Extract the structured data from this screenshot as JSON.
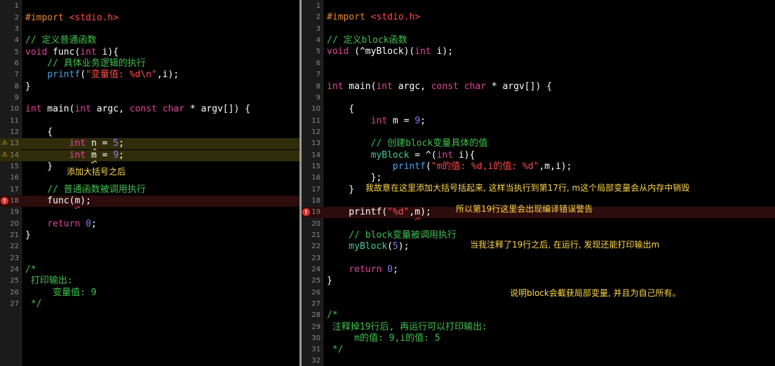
{
  "left": {
    "lines": [
      {
        "n": "1",
        "parts": []
      },
      {
        "n": "2",
        "parts": [
          {
            "c": "pp",
            "t": "#import "
          },
          {
            "c": "str",
            "t": "<stdio.h>"
          }
        ]
      },
      {
        "n": "3",
        "parts": []
      },
      {
        "n": "4",
        "parts": [
          {
            "c": "cm",
            "t": "// 定义普通函数"
          }
        ]
      },
      {
        "n": "5",
        "parts": [
          {
            "c": "kw",
            "t": "void"
          },
          {
            "c": "plain",
            "t": " func("
          },
          {
            "c": "kw",
            "t": "int"
          },
          {
            "c": "plain",
            "t": " i){"
          }
        ]
      },
      {
        "n": "6",
        "parts": [
          {
            "c": "cm",
            "t": "    // 具体业务逻辑的执行"
          }
        ]
      },
      {
        "n": "7",
        "parts": [
          {
            "c": "plain",
            "t": "    "
          },
          {
            "c": "fn",
            "t": "printf"
          },
          {
            "c": "plain",
            "t": "("
          },
          {
            "c": "str",
            "t": "\"变量值: %d\\n\""
          },
          {
            "c": "plain",
            "t": ",i);"
          }
        ]
      },
      {
        "n": "8",
        "parts": [
          {
            "c": "plain",
            "t": "}"
          }
        ]
      },
      {
        "n": "9",
        "parts": []
      },
      {
        "n": "10",
        "parts": [
          {
            "c": "kw",
            "t": "int"
          },
          {
            "c": "plain",
            "t": " main("
          },
          {
            "c": "kw",
            "t": "int"
          },
          {
            "c": "plain",
            "t": " argc, "
          },
          {
            "c": "kw",
            "t": "const char"
          },
          {
            "c": "plain",
            "t": " * argv[]) {"
          }
        ]
      },
      {
        "n": "11",
        "parts": []
      },
      {
        "n": "12",
        "parts": [
          {
            "c": "plain",
            "t": "    {"
          }
        ]
      },
      {
        "n": "13",
        "mark": "warn",
        "parts": [
          {
            "c": "plain",
            "t": "        "
          },
          {
            "c": "kw",
            "t": "int"
          },
          {
            "c": "plain",
            "t": " "
          },
          {
            "c": "plain squig",
            "t": "n"
          },
          {
            "c": "plain",
            "t": " = "
          },
          {
            "c": "num",
            "t": "5"
          },
          {
            "c": "plain",
            "t": ";"
          }
        ]
      },
      {
        "n": "14",
        "mark": "warn",
        "parts": [
          {
            "c": "plain",
            "t": "        "
          },
          {
            "c": "kw",
            "t": "int"
          },
          {
            "c": "plain",
            "t": " "
          },
          {
            "c": "plain squig",
            "t": "m"
          },
          {
            "c": "plain",
            "t": " = "
          },
          {
            "c": "num",
            "t": "9"
          },
          {
            "c": "plain",
            "t": ";"
          }
        ]
      },
      {
        "n": "15",
        "parts": [
          {
            "c": "plain",
            "t": "    }"
          }
        ]
      },
      {
        "n": "16",
        "parts": []
      },
      {
        "n": "17",
        "parts": [
          {
            "c": "cm",
            "t": "    // 普通函数被调用执行"
          }
        ]
      },
      {
        "n": "18",
        "mark": "err",
        "parts": [
          {
            "c": "plain",
            "t": "    func("
          },
          {
            "c": "plain squig-r",
            "t": "m"
          },
          {
            "c": "plain",
            "t": ");"
          }
        ]
      },
      {
        "n": "19",
        "parts": []
      },
      {
        "n": "20",
        "parts": [
          {
            "c": "plain",
            "t": "    "
          },
          {
            "c": "kw",
            "t": "return"
          },
          {
            "c": "plain",
            "t": " "
          },
          {
            "c": "num",
            "t": "0"
          },
          {
            "c": "plain",
            "t": ";"
          }
        ]
      },
      {
        "n": "21",
        "parts": [
          {
            "c": "plain",
            "t": "}"
          }
        ]
      },
      {
        "n": "22",
        "parts": []
      },
      {
        "n": "23",
        "parts": []
      },
      {
        "n": "24",
        "parts": [
          {
            "c": "cm",
            "t": "/*"
          }
        ]
      },
      {
        "n": "25",
        "parts": [
          {
            "c": "cm",
            "t": " 打印输出:"
          }
        ]
      },
      {
        "n": "26",
        "parts": [
          {
            "c": "cm",
            "t": "     变量值: 9"
          }
        ]
      },
      {
        "n": "27",
        "parts": [
          {
            "c": "cm",
            "t": " */"
          }
        ]
      }
    ],
    "notes": {
      "brace_note": "添加大括号之后"
    }
  },
  "right": {
    "lines": [
      {
        "n": "1",
        "parts": []
      },
      {
        "n": "2",
        "parts": [
          {
            "c": "pp",
            "t": "#import "
          },
          {
            "c": "str",
            "t": "<stdio.h>"
          }
        ]
      },
      {
        "n": "3",
        "parts": []
      },
      {
        "n": "4",
        "parts": [
          {
            "c": "cm",
            "t": "// 定义block函数"
          }
        ]
      },
      {
        "n": "5",
        "parts": [
          {
            "c": "kw",
            "t": "void"
          },
          {
            "c": "plain",
            "t": " (^myBlock)("
          },
          {
            "c": "kw",
            "t": "int"
          },
          {
            "c": "plain",
            "t": " i);"
          }
        ]
      },
      {
        "n": "6",
        "parts": []
      },
      {
        "n": "7",
        "parts": []
      },
      {
        "n": "8",
        "parts": [
          {
            "c": "kw",
            "t": "int"
          },
          {
            "c": "plain",
            "t": " main("
          },
          {
            "c": "kw",
            "t": "int"
          },
          {
            "c": "plain",
            "t": " argc, "
          },
          {
            "c": "kw",
            "t": "const char"
          },
          {
            "c": "plain",
            "t": " * argv[]) {"
          }
        ]
      },
      {
        "n": "9",
        "parts": []
      },
      {
        "n": "10",
        "parts": [
          {
            "c": "plain",
            "t": "    {"
          }
        ]
      },
      {
        "n": "11",
        "parts": [
          {
            "c": "plain",
            "t": "        "
          },
          {
            "c": "kw",
            "t": "int"
          },
          {
            "c": "plain",
            "t": " m = "
          },
          {
            "c": "num",
            "t": "9"
          },
          {
            "c": "plain",
            "t": ";"
          }
        ]
      },
      {
        "n": "12",
        "parts": []
      },
      {
        "n": "13",
        "parts": [
          {
            "c": "cm",
            "t": "        // 创建block变量具体的值"
          }
        ]
      },
      {
        "n": "14",
        "parts": [
          {
            "c": "ufn",
            "t": "        myBlock"
          },
          {
            "c": "plain",
            "t": " = ^("
          },
          {
            "c": "kw",
            "t": "int"
          },
          {
            "c": "plain",
            "t": " i){"
          }
        ]
      },
      {
        "n": "15",
        "parts": [
          {
            "c": "plain",
            "t": "            "
          },
          {
            "c": "fn",
            "t": "printf"
          },
          {
            "c": "plain",
            "t": "("
          },
          {
            "c": "str",
            "t": "\"m的值: %d,i的值: %d\""
          },
          {
            "c": "plain",
            "t": ",m,i);"
          }
        ]
      },
      {
        "n": "16",
        "parts": [
          {
            "c": "plain",
            "t": "        };"
          }
        ]
      },
      {
        "n": "17",
        "parts": [
          {
            "c": "plain",
            "t": "    }"
          }
        ]
      },
      {
        "n": "18",
        "parts": []
      },
      {
        "n": "19",
        "mark": "err",
        "parts": [
          {
            "c": "plain",
            "t": "    printf("
          },
          {
            "c": "str",
            "t": "\"%d\""
          },
          {
            "c": "plain",
            "t": ","
          },
          {
            "c": "plain squig-r",
            "t": "m"
          },
          {
            "c": "plain",
            "t": ");"
          }
        ]
      },
      {
        "n": "20",
        "parts": []
      },
      {
        "n": "21",
        "parts": [
          {
            "c": "cm",
            "t": "    // block变量被调用执行"
          }
        ]
      },
      {
        "n": "22",
        "parts": [
          {
            "c": "ufn",
            "t": "    myBlock"
          },
          {
            "c": "plain",
            "t": "("
          },
          {
            "c": "num",
            "t": "5"
          },
          {
            "c": "plain",
            "t": ");"
          }
        ]
      },
      {
        "n": "23",
        "parts": []
      },
      {
        "n": "24",
        "parts": [
          {
            "c": "plain",
            "t": "    "
          },
          {
            "c": "kw",
            "t": "return"
          },
          {
            "c": "plain",
            "t": " "
          },
          {
            "c": "num",
            "t": "0"
          },
          {
            "c": "plain",
            "t": ";"
          }
        ]
      },
      {
        "n": "25",
        "parts": [
          {
            "c": "plain",
            "t": "}"
          }
        ]
      },
      {
        "n": "26",
        "parts": []
      },
      {
        "n": "27",
        "parts": []
      },
      {
        "n": "28",
        "parts": [
          {
            "c": "cm",
            "t": "/*"
          }
        ]
      },
      {
        "n": "29",
        "parts": [
          {
            "c": "cm",
            "t": " 注释掉19行后, 再运行可以打印输出:"
          }
        ]
      },
      {
        "n": "30",
        "parts": [
          {
            "c": "cm",
            "t": "     m的值: 9,i的值: 5"
          }
        ]
      },
      {
        "n": "31",
        "parts": [
          {
            "c": "cm",
            "t": " */"
          }
        ]
      },
      {
        "n": "32",
        "parts": []
      }
    ],
    "notes": {
      "brace_note": "我故意在这里添加大括号括起来, 这样当执行到第17行, m这个局部变量会从内存中销毁",
      "error_note": "所以第19行这里会出现编译错误警告",
      "comment_note": "当我注释了19行之后, 在运行, 发现还能打印输出m",
      "conclusion_note": "说明block会截获局部变量, 并且为自己所有。"
    }
  },
  "colors": {
    "keyword": "#e0459b",
    "comment": "#41c14f",
    "string": "#ff4a4a",
    "number": "#8a7cf0",
    "preprocessor": "#e7872f",
    "function": "#49a4ee",
    "annotation": "#ffd84a",
    "warning": "#f6c341",
    "error": "#e0312c"
  },
  "icons": {
    "warning": "warning-triangle-icon",
    "error": "error-circle-icon"
  }
}
